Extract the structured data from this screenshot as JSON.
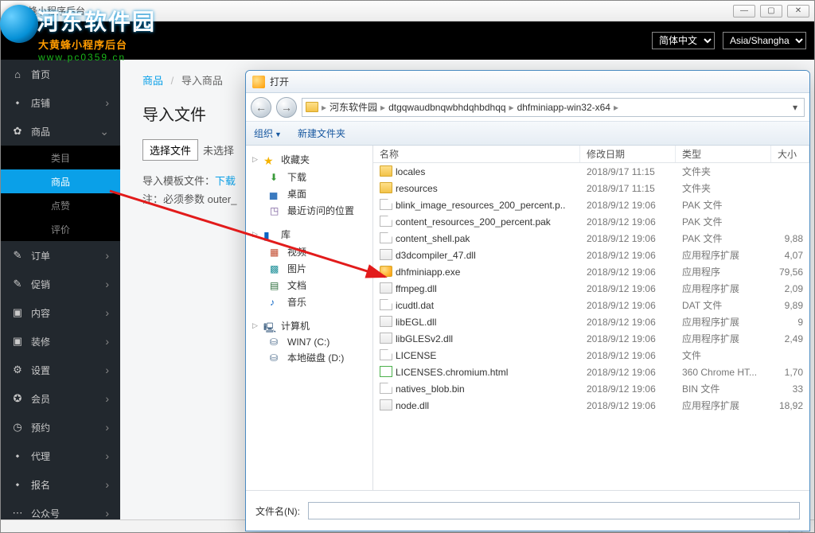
{
  "app": {
    "title": "大黄蜂小程序后台",
    "lang_value": "简体中文",
    "tz_value": "Asia/Shangha"
  },
  "watermark": {
    "title": "河东软件园",
    "sub": "大黄蜂小程序后台",
    "url": "www.pc0359.cn"
  },
  "sidebar": {
    "items": [
      {
        "icon": "⌂",
        "label": "首页",
        "expandable": false
      },
      {
        "icon": "⬩",
        "label": "店铺",
        "expandable": true
      },
      {
        "icon": "✿",
        "label": "商品",
        "expandable": true,
        "open": true,
        "children": [
          {
            "label": "类目"
          },
          {
            "label": "商品",
            "active": true
          },
          {
            "label": "点赞"
          },
          {
            "label": "评价"
          }
        ]
      },
      {
        "icon": "✎",
        "label": "订单",
        "expandable": true
      },
      {
        "icon": "✎",
        "label": "促销",
        "expandable": true
      },
      {
        "icon": "▣",
        "label": "内容",
        "expandable": true
      },
      {
        "icon": "▣",
        "label": "装修",
        "expandable": true
      },
      {
        "icon": "⚙",
        "label": "设置",
        "expandable": true
      },
      {
        "icon": "✪",
        "label": "会员",
        "expandable": true
      },
      {
        "icon": "◷",
        "label": "预约",
        "expandable": true
      },
      {
        "icon": "⬩",
        "label": "代理",
        "expandable": true
      },
      {
        "icon": "⬩",
        "label": "报名",
        "expandable": true
      },
      {
        "icon": "⋯",
        "label": "公众号",
        "expandable": true
      }
    ]
  },
  "content": {
    "breadcrumb": {
      "root": "商品",
      "cur": "导入商品"
    },
    "heading": "导入文件",
    "choose_btn": "选择文件",
    "nofile": "未选择",
    "tmpl_prefix": "导入模板文件：",
    "tmpl_link": "下载",
    "note": "注：必须参数 outer_"
  },
  "dialog": {
    "title": "打开",
    "crumbs": [
      "河东软件园",
      "dtgqwaudbnqwbhdqhbdhqq",
      "dhfminiapp-win32-x64"
    ],
    "toolbar": {
      "org": "组织",
      "newfolder": "新建文件夹"
    },
    "tree": {
      "fav": {
        "head": "收藏夹",
        "items": [
          "下载",
          "桌面",
          "最近访问的位置"
        ]
      },
      "lib": {
        "head": "库",
        "items": [
          "视频",
          "图片",
          "文档",
          "音乐"
        ]
      },
      "pc": {
        "head": "计算机",
        "items": [
          "WIN7 (C:)",
          "本地磁盘 (D:)"
        ]
      }
    },
    "columns": {
      "name": "名称",
      "date": "修改日期",
      "type": "类型",
      "size": "大小"
    },
    "files": [
      {
        "icon": "folder",
        "name": "locales",
        "date": "2018/9/17 11:15",
        "type": "文件夹",
        "size": ""
      },
      {
        "icon": "folder",
        "name": "resources",
        "date": "2018/9/17 11:15",
        "type": "文件夹",
        "size": ""
      },
      {
        "icon": "file",
        "name": "blink_image_resources_200_percent.p..",
        "date": "2018/9/12 19:06",
        "type": "PAK 文件",
        "size": ""
      },
      {
        "icon": "file",
        "name": "content_resources_200_percent.pak",
        "date": "2018/9/12 19:06",
        "type": "PAK 文件",
        "size": ""
      },
      {
        "icon": "file",
        "name": "content_shell.pak",
        "date": "2018/9/12 19:06",
        "type": "PAK 文件",
        "size": "9,88"
      },
      {
        "icon": "dll",
        "name": "d3dcompiler_47.dll",
        "date": "2018/9/12 19:06",
        "type": "应用程序扩展",
        "size": "4,07"
      },
      {
        "icon": "exe",
        "name": "dhfminiapp.exe",
        "date": "2018/9/12 19:06",
        "type": "应用程序",
        "size": "79,56"
      },
      {
        "icon": "dll",
        "name": "ffmpeg.dll",
        "date": "2018/9/12 19:06",
        "type": "应用程序扩展",
        "size": "2,09"
      },
      {
        "icon": "file",
        "name": "icudtl.dat",
        "date": "2018/9/12 19:06",
        "type": "DAT 文件",
        "size": "9,89"
      },
      {
        "icon": "dll",
        "name": "libEGL.dll",
        "date": "2018/9/12 19:06",
        "type": "应用程序扩展",
        "size": "9"
      },
      {
        "icon": "dll",
        "name": "libGLESv2.dll",
        "date": "2018/9/12 19:06",
        "type": "应用程序扩展",
        "size": "2,49"
      },
      {
        "icon": "file",
        "name": "LICENSE",
        "date": "2018/9/12 19:06",
        "type": "文件",
        "size": ""
      },
      {
        "icon": "html",
        "name": "LICENSES.chromium.html",
        "date": "2018/9/12 19:06",
        "type": "360 Chrome HT...",
        "size": "1,70"
      },
      {
        "icon": "file",
        "name": "natives_blob.bin",
        "date": "2018/9/12 19:06",
        "type": "BIN 文件",
        "size": "33"
      },
      {
        "icon": "dll",
        "name": "node.dll",
        "date": "2018/9/12 19:06",
        "type": "应用程序扩展",
        "size": "18,92"
      }
    ],
    "filename_label": "文件名(N):"
  }
}
